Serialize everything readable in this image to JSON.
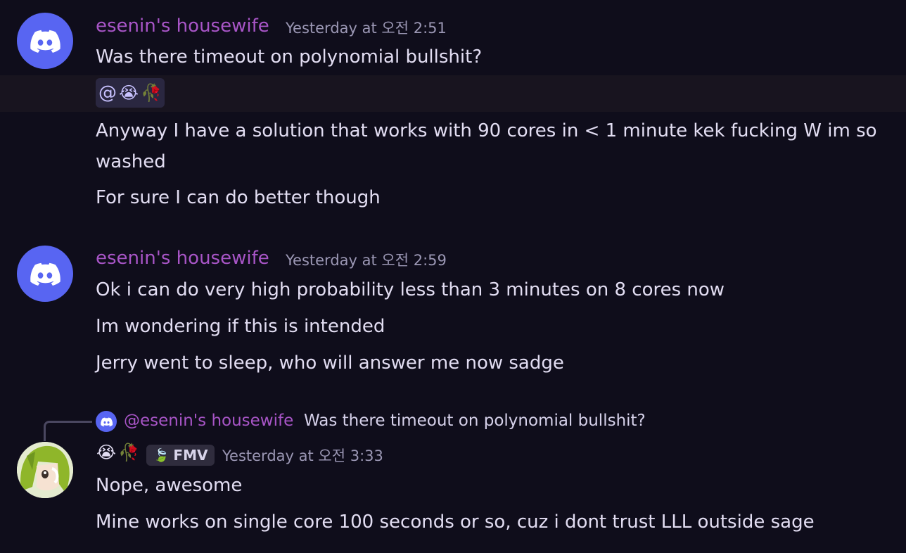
{
  "messages": [
    {
      "username": "esenin's housewife",
      "timestamp": "Yesterday at 오전 2:51",
      "lines": [
        "Was there timeout on polynomial bullshit?",
        "Anyway I have a solution that works with 90 cores in < 1 minute kek fucking W im so washed",
        "For sure I can do better though"
      ],
      "mention_chip": "@"
    },
    {
      "username": "esenin's housewife",
      "timestamp": "Yesterday at 오전 2:59",
      "lines": [
        "Ok i can do very high probability less than 3 minutes on 8 cores now",
        "Im wondering if this is intended",
        "Jerry went to sleep, who will answer me now sadge"
      ]
    },
    {
      "reply_mention": "@esenin's housewife",
      "reply_text": "Was there timeout on polynomial bullshit?",
      "tag": "FMV",
      "timestamp": "Yesterday at 오전 3:33",
      "lines": [
        "Nope, awesome",
        "Mine works on single core 100 seconds or so, cuz i dont trust LLL outside sage"
      ]
    }
  ],
  "icons": {
    "discord": "discord-logo-icon",
    "crying": "crying-face-icon",
    "rose": "wilted-rose-icon",
    "leaf": "leaf-icon"
  },
  "colors": {
    "background": "#0f0d1b",
    "username": "#a855c7",
    "discord_blurple": "#5865f2",
    "timestamp": "#9b97b4"
  }
}
